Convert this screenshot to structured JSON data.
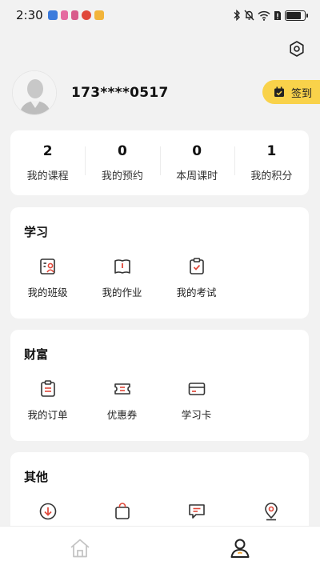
{
  "status_bar": {
    "time": "2:30",
    "notification_icons": [
      {
        "name": "shield-app-icon",
        "color": "#3b7bdc"
      },
      {
        "name": "pink-app-icon",
        "color": "#e56aa0"
      },
      {
        "name": "pink-app-icon-2",
        "color": "#d85c8c"
      },
      {
        "name": "weibo-icon",
        "color": "#e0483a"
      },
      {
        "name": "yellow-app-icon",
        "color": "#f2b43a"
      }
    ],
    "battery_level": 0.8
  },
  "profile": {
    "phone": "173****0517",
    "checkin_label": "签到"
  },
  "stats": [
    {
      "value": "2",
      "label": "我的课程"
    },
    {
      "value": "0",
      "label": "我的预约"
    },
    {
      "value": "0",
      "label": "本周课时"
    },
    {
      "value": "1",
      "label": "我的积分"
    }
  ],
  "sections": {
    "study": {
      "title": "学习",
      "items": [
        {
          "label": "我的班级",
          "icon": "class-icon"
        },
        {
          "label": "我的作业",
          "icon": "homework-icon"
        },
        {
          "label": "我的考试",
          "icon": "exam-icon"
        }
      ]
    },
    "wealth": {
      "title": "财富",
      "items": [
        {
          "label": "我的订单",
          "icon": "order-icon"
        },
        {
          "label": "优惠券",
          "icon": "coupon-icon"
        },
        {
          "label": "学习卡",
          "icon": "study-card-icon"
        }
      ]
    },
    "other": {
      "title": "其他",
      "items": [
        {
          "label": "",
          "icon": "download-icon"
        },
        {
          "label": "",
          "icon": "shopping-bag-icon"
        },
        {
          "label": "",
          "icon": "message-icon"
        },
        {
          "label": "",
          "icon": "location-icon"
        }
      ]
    }
  },
  "tab_bar": {
    "tabs": [
      {
        "name": "home",
        "icon": "home-icon",
        "active": false
      },
      {
        "name": "profile",
        "icon": "person-icon",
        "active": true
      }
    ]
  },
  "colors": {
    "accent_yellow": "#f9d24a",
    "icon_dark": "#333333",
    "icon_red": "#e0483a",
    "background": "#f2f2f2"
  }
}
